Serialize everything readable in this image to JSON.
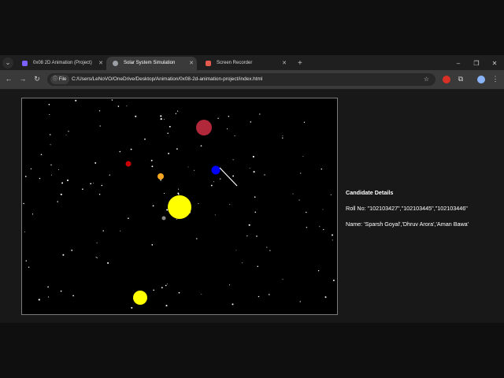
{
  "browser": {
    "tabs": [
      {
        "title": "0x08 2D Animation (Project)",
        "icon": "purple-doc-icon",
        "color": "#7b61ff"
      },
      {
        "title": "Solar System Simulation",
        "icon": "globe-icon",
        "color": "#9aa0a6",
        "active": true
      },
      {
        "title": "Screen Recorder",
        "icon": "recorder-icon",
        "color": "#e35a4f"
      }
    ],
    "new_tab_label": "+",
    "url_chip": "File",
    "url": "C:/Users/LeNoVO/OneDrive/Desktop/Animation/0x08-2d-animation-project/index.html"
  },
  "scene": {
    "bodies": [
      {
        "name": "sun",
        "color": "#ffff00"
      },
      {
        "name": "planet-red-large",
        "color": "#b0283a"
      },
      {
        "name": "planet-red-small",
        "color": "#cc0000"
      },
      {
        "name": "planet-orange",
        "color": "#f5a623"
      },
      {
        "name": "planet-blue",
        "color": "#0000ff"
      },
      {
        "name": "planet-gray",
        "color": "#888888"
      },
      {
        "name": "sun-secondary",
        "color": "#ffff00"
      }
    ],
    "pointer_color": "#ffffff",
    "star_color": "#ffffff"
  },
  "details": {
    "heading": "Candidate Details",
    "roll": "Roll No: \"102103427\",\"102103445\",\"102103446\"",
    "names": "Name: 'Sparsh Goyal','Dhruv Arora','Aman Bawa'"
  }
}
